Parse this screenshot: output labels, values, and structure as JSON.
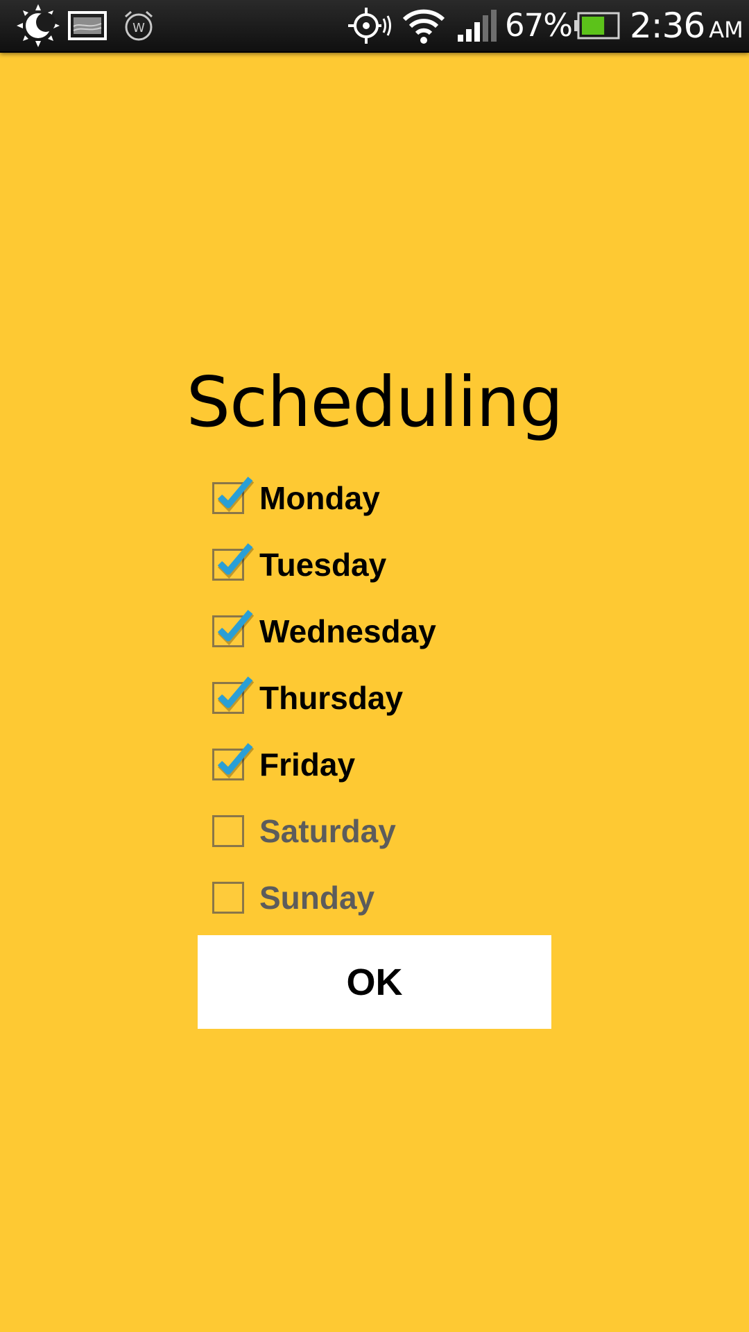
{
  "status_bar": {
    "icons_left": [
      "brightness-icon",
      "image-notification-icon",
      "alarm-icon"
    ],
    "icons_right": [
      "gps-icon",
      "wifi-icon",
      "signal-icon",
      "battery-icon"
    ],
    "battery_percent": "67%",
    "time": "2:36",
    "am_pm": "AM",
    "battery_level": 0.67
  },
  "title": "Scheduling",
  "days": [
    {
      "label": "Monday",
      "checked": true
    },
    {
      "label": "Tuesday",
      "checked": true
    },
    {
      "label": "Wednesday",
      "checked": true
    },
    {
      "label": "Thursday",
      "checked": true
    },
    {
      "label": "Friday",
      "checked": true
    },
    {
      "label": "Saturday",
      "checked": false
    },
    {
      "label": "Sunday",
      "checked": false
    }
  ],
  "ok_button": {
    "label": "OK"
  },
  "colors": {
    "background": "#fec933",
    "checkmark": "#2a9fd6",
    "checked_text": "#000000",
    "unchecked_text": "#5c5c5c",
    "button_bg": "#ffffff"
  }
}
